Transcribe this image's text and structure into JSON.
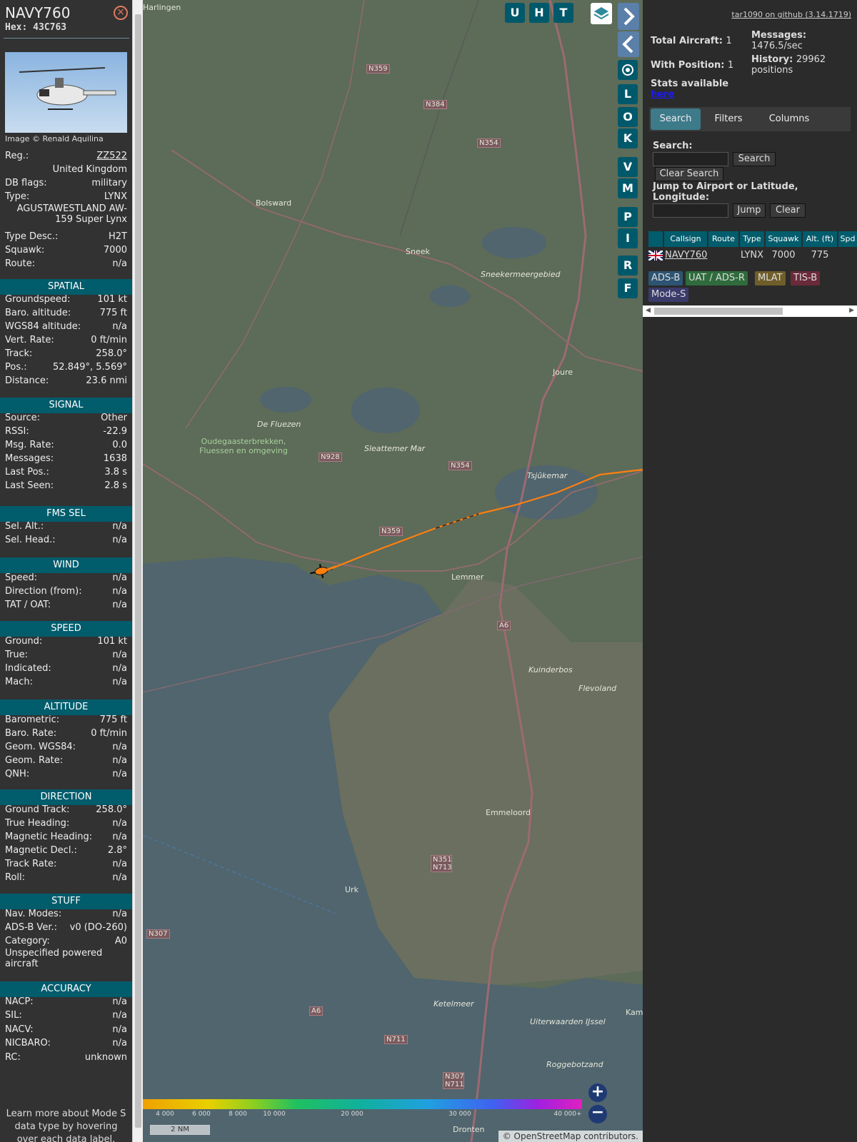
{
  "aircraft": {
    "callsign": "NAVY760",
    "hex_label": "Hex:",
    "hex": "43C763",
    "close_glyph": "×",
    "image_credit": "Image © Renald Aquilina",
    "reg_label": "Reg.:",
    "reg": "ZZ522",
    "country": "United Kingdom",
    "dbflags_label": "DB flags:",
    "dbflags": "military",
    "type_label": "Type:",
    "type": "LYNX",
    "type_full": "AGUSTAWESTLAND AW-159 Super Lynx",
    "typedesc_label": "Type Desc.:",
    "typedesc": "H2T",
    "squawk_label": "Squawk:",
    "squawk": "7000",
    "route_label": "Route:",
    "route": "n/a"
  },
  "sections": {
    "spatial": "SPATIAL",
    "signal": "SIGNAL",
    "fms": "FMS SEL",
    "wind": "WIND",
    "speed": "SPEED",
    "altitude": "ALTITUDE",
    "direction": "DIRECTION",
    "stuff": "STUFF",
    "accuracy": "ACCURACY"
  },
  "spatial": [
    [
      "Groundspeed:",
      "101 kt"
    ],
    [
      "Baro. altitude:",
      "775 ft"
    ],
    [
      "WGS84 altitude:",
      "n/a"
    ],
    [
      "Vert. Rate:",
      "0 ft/min"
    ],
    [
      "Track:",
      "258.0°"
    ],
    [
      "Pos.:",
      "52.849°, 5.569°"
    ],
    [
      "Distance:",
      "23.6 nmi"
    ]
  ],
  "signal": [
    [
      "Source:",
      "Other"
    ],
    [
      "RSSI:",
      "-22.9"
    ],
    [
      "Msg. Rate:",
      "0.0"
    ],
    [
      "Messages:",
      "1638"
    ],
    [
      "Last Pos.:",
      "3.8 s"
    ],
    [
      "Last Seen:",
      "2.8 s"
    ]
  ],
  "fms": [
    [
      "Sel. Alt.:",
      "n/a"
    ],
    [
      "Sel. Head.:",
      "n/a"
    ]
  ],
  "wind": [
    [
      "Speed:",
      "n/a"
    ],
    [
      "Direction (from):",
      "n/a"
    ],
    [
      "TAT / OAT:",
      "n/a"
    ]
  ],
  "speed": [
    [
      "Ground:",
      "101 kt"
    ],
    [
      "True:",
      "n/a"
    ],
    [
      "Indicated:",
      "n/a"
    ],
    [
      "Mach:",
      "n/a"
    ]
  ],
  "altitude": [
    [
      "Barometric:",
      "775 ft"
    ],
    [
      "Baro. Rate:",
      "0 ft/min"
    ],
    [
      "Geom. WGS84:",
      "n/a"
    ],
    [
      "Geom. Rate:",
      "n/a"
    ],
    [
      "QNH:",
      "n/a"
    ]
  ],
  "direction": [
    [
      "Ground Track:",
      "258.0°"
    ],
    [
      "True Heading:",
      "n/a"
    ],
    [
      "Magnetic Heading:",
      "n/a"
    ],
    [
      "Magnetic Decl.:",
      "2.8°"
    ],
    [
      "Track Rate:",
      "n/a"
    ],
    [
      "Roll:",
      "n/a"
    ]
  ],
  "stuff": [
    [
      "Nav. Modes:",
      "n/a"
    ],
    [
      "ADS-B Ver.:",
      "v0 (DO-260)"
    ],
    [
      "Category:",
      "A0"
    ]
  ],
  "stuff_category_desc": "Unspecified powered aircraft",
  "accuracy": [
    [
      "NACP:",
      "n/a"
    ],
    [
      "SIL:",
      "n/a"
    ],
    [
      "NACV:",
      "n/a"
    ],
    [
      "NICBARO:",
      "n/a"
    ],
    [
      "RC:",
      "unknown"
    ]
  ],
  "footer_note": "Learn more about Mode S data type by hovering over each data label.",
  "map": {
    "buttons": [
      "U",
      "H",
      "T",
      "L",
      "O",
      "K",
      "V",
      "M",
      "P",
      "I",
      "R",
      "F"
    ],
    "places": [
      {
        "name": "Harlingen"
      },
      {
        "name": "Bolsward"
      },
      {
        "name": "Sneek"
      },
      {
        "name": "Sneekermeergebied"
      },
      {
        "name": "Joure"
      },
      {
        "name": "De Fluezen"
      },
      {
        "name": "Oudegaasterbrekken, Fluessen en omgeving"
      },
      {
        "name": "Sleattemer Mar"
      },
      {
        "name": "Tsjûkemar"
      },
      {
        "name": "Lemmer"
      },
      {
        "name": "Kuinderbos"
      },
      {
        "name": "Flevoland"
      },
      {
        "name": "Emmeloord"
      },
      {
        "name": "Urk"
      },
      {
        "name": "Ketelmeer"
      },
      {
        "name": "Uiterwaarden IJssel"
      },
      {
        "name": "Roggebotzand"
      },
      {
        "name": "Dronten"
      },
      {
        "name": "Kamp"
      }
    ],
    "road_labels": [
      "N359",
      "N384",
      "N354",
      "N928",
      "N354",
      "N359",
      "A6",
      "N351 N713",
      "N307",
      "A6",
      "N711",
      "N307 N711"
    ],
    "altitude_scale": [
      "4 000",
      "6 000",
      "8 000",
      "10 000",
      "20 000",
      "30 000",
      "40 000+"
    ],
    "scale_label": "2 NM",
    "attribution": "© OpenStreetMap contributors."
  },
  "stats": {
    "github_link": "tar1090 on github (3.14.1719)",
    "total_label": "Total Aircraft:",
    "total": "1",
    "messages_label": "Messages:",
    "messages": "1476.5/sec",
    "position_label": "With Position:",
    "position": "1",
    "history_label": "History:",
    "history": "29962 positions",
    "stats_label": "Stats available",
    "stats_link": "here"
  },
  "tabs": [
    "Search",
    "Filters",
    "Columns"
  ],
  "search": {
    "search_label": "Search:",
    "search_button": "Search",
    "clear_search": "Clear Search",
    "jump_label": "Jump to Airport or Latitude, Longitude:",
    "jump_button": "Jump",
    "clear_button": "Clear"
  },
  "table": {
    "headers": [
      "",
      "Callsign",
      "Route",
      "Type",
      "Squawk",
      "Alt. (ft)",
      "Spd"
    ],
    "row": {
      "callsign": "NAVY760",
      "route": "",
      "type": "LYNX",
      "squawk": "7000",
      "alt": "775"
    }
  },
  "source_chips": [
    "ADS-B",
    "UAT / ADS-R",
    "MLAT",
    "TIS-B",
    "Mode-S"
  ],
  "colors": {
    "accent": "#015c6c",
    "track": "#ff7f0e"
  }
}
